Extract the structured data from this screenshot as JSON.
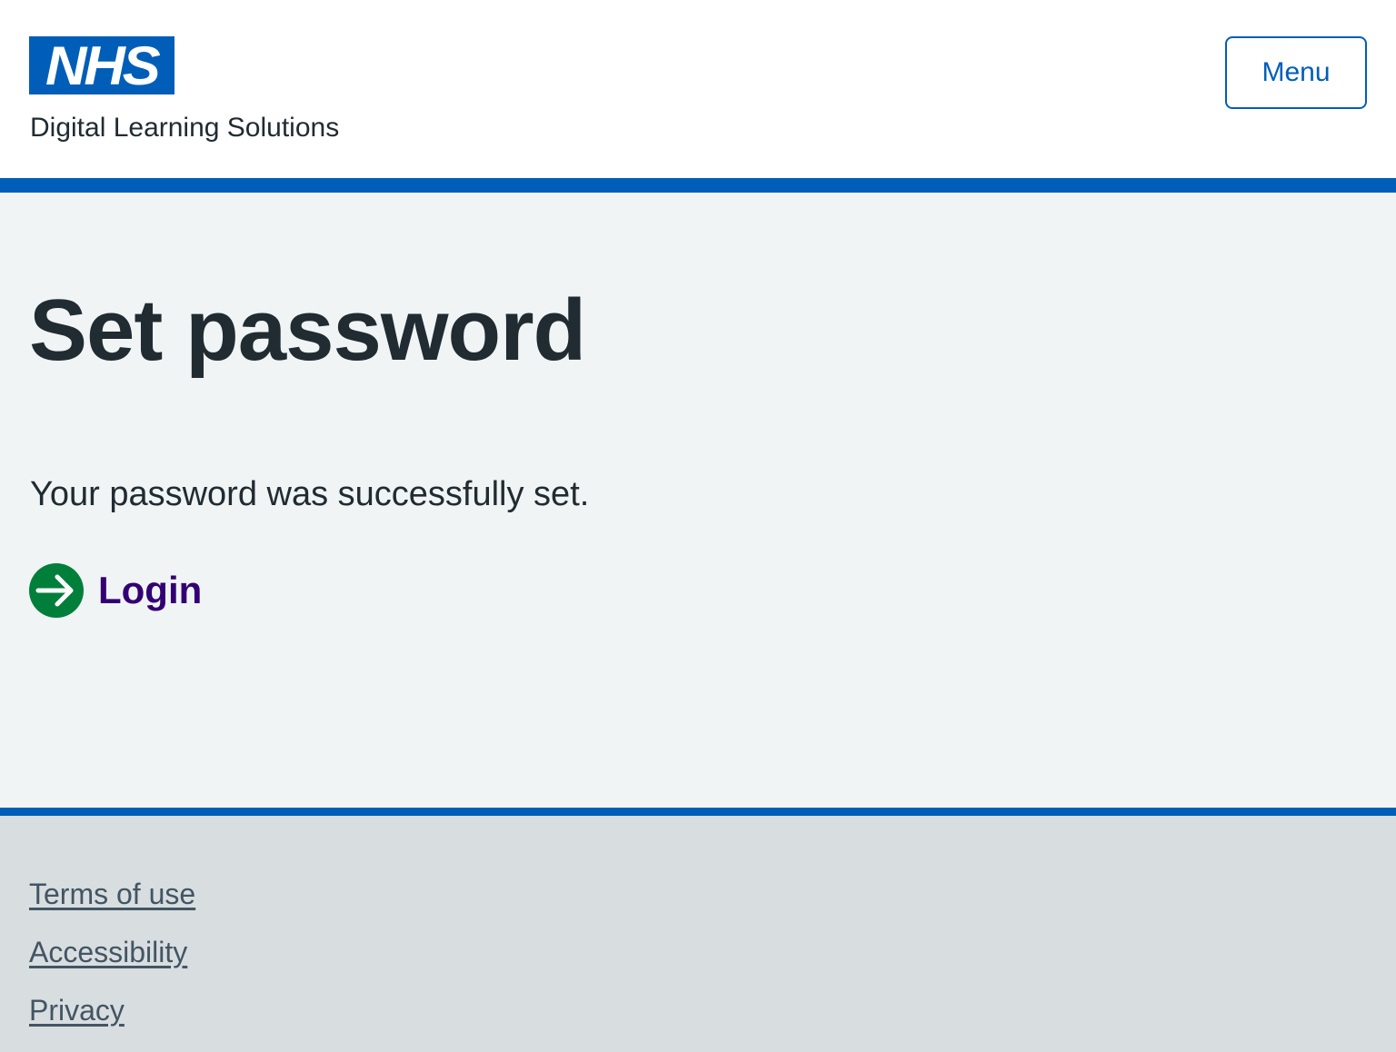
{
  "header": {
    "logo_text": "NHS",
    "service_name": "Digital Learning Solutions",
    "menu_label": "Menu"
  },
  "main": {
    "title": "Set password",
    "message": "Your password was successfully set.",
    "action_link": {
      "label": "Login",
      "icon": "arrow-right-circle-icon"
    }
  },
  "footer": {
    "links": [
      "Terms of use",
      "Accessibility",
      "Privacy"
    ]
  },
  "colors": {
    "nhs_blue": "#005eb8",
    "page_background": "#f0f4f5",
    "footer_background": "#d8dde0",
    "action_icon_green": "#007f3b",
    "link_visited_purple": "#330072",
    "text": "#212b32",
    "footer_link": "#425563"
  }
}
